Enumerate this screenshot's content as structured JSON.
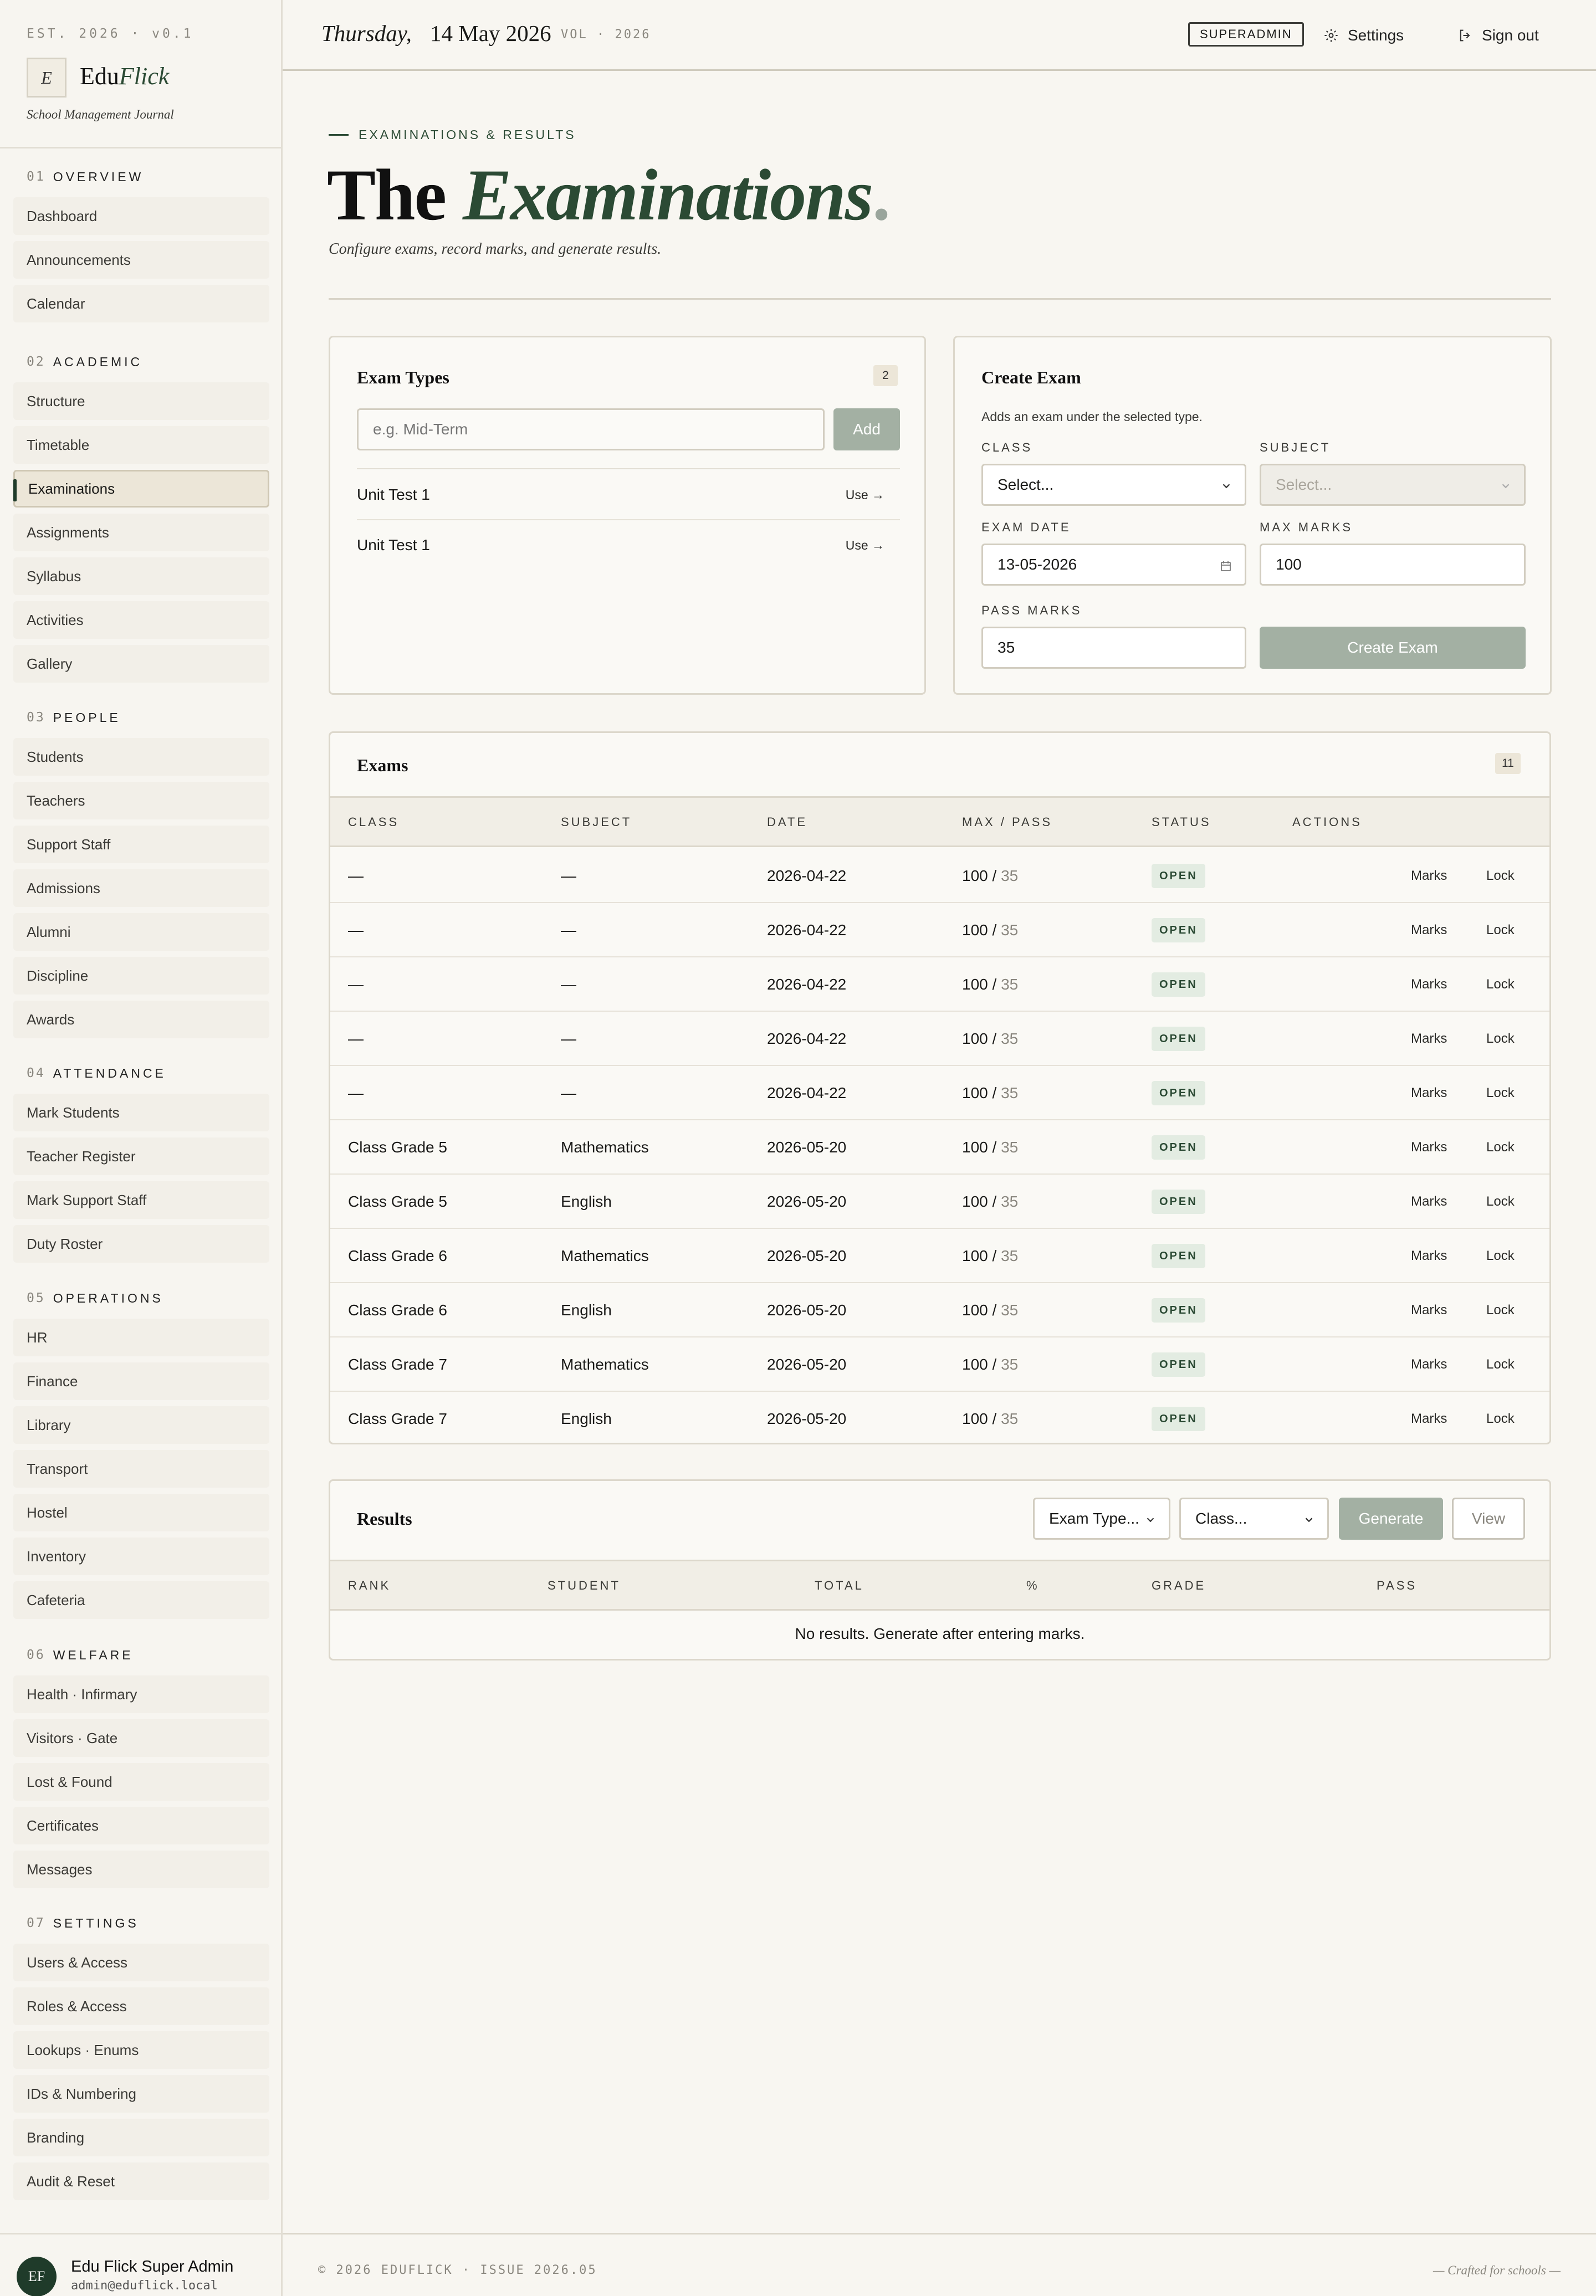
{
  "brand": {
    "est": "EST. 2026 · v0.1",
    "mark": "E",
    "name_prefix": "Edu",
    "name_suffix": "Flick",
    "tagline": "School Management Journal"
  },
  "nav": [
    {
      "num": "01",
      "heading": "OVERVIEW",
      "items": [
        "Dashboard",
        "Announcements",
        "Calendar"
      ]
    },
    {
      "num": "02",
      "heading": "ACADEMIC",
      "items": [
        "Structure",
        "Timetable",
        "Examinations",
        "Assignments",
        "Syllabus",
        "Activities",
        "Gallery"
      ]
    },
    {
      "num": "03",
      "heading": "PEOPLE",
      "items": [
        "Students",
        "Teachers",
        "Support Staff",
        "Admissions",
        "Alumni",
        "Discipline",
        "Awards"
      ]
    },
    {
      "num": "04",
      "heading": "ATTENDANCE",
      "items": [
        "Mark Students",
        "Teacher Register",
        "Mark Support Staff",
        "Duty Roster"
      ]
    },
    {
      "num": "05",
      "heading": "OPERATIONS",
      "items": [
        "HR",
        "Finance",
        "Library",
        "Transport",
        "Hostel",
        "Inventory",
        "Cafeteria"
      ]
    },
    {
      "num": "06",
      "heading": "WELFARE",
      "items": [
        "Health · Infirmary",
        "Visitors · Gate",
        "Lost & Found",
        "Certificates",
        "Messages"
      ]
    },
    {
      "num": "07",
      "heading": "SETTINGS",
      "items": [
        "Users & Access",
        "Roles & Access",
        "Lookups · Enums",
        "IDs & Numbering",
        "Branding",
        "Audit & Reset"
      ]
    }
  ],
  "active_nav": "Examinations",
  "user": {
    "initials": "EF",
    "name": "Edu Flick Super Admin",
    "email": "admin@eduflick.local"
  },
  "topbar": {
    "day": "Thursday,",
    "date": "14 May 2026",
    "vol": "VOL · 2026",
    "role": "SUPERADMIN",
    "settings": "Settings",
    "signout": "Sign out"
  },
  "page": {
    "eyebrow": "EXAMINATIONS & RESULTS",
    "title_plain": "The",
    "title_em": "Examinations",
    "title_dot": ".",
    "subtitle": "Configure exams, record marks, and generate results."
  },
  "exam_types": {
    "title": "Exam Types",
    "count": "2",
    "placeholder": "e.g. Mid-Term",
    "add": "Add",
    "items": [
      {
        "name": "Unit Test 1",
        "action": "Use →"
      },
      {
        "name": "Unit Test 1",
        "action": "Use →"
      }
    ]
  },
  "create_exam": {
    "title": "Create Exam",
    "hint": "Adds an exam under the selected type.",
    "class_label": "CLASS",
    "class_value": "Select...",
    "subject_label": "SUBJECT",
    "subject_value": "Select...",
    "date_label": "EXAM DATE",
    "date_value": "13-05-2026",
    "max_label": "MAX MARKS",
    "max_value": "100",
    "pass_label": "PASS MARKS",
    "pass_value": "35",
    "submit": "Create Exam"
  },
  "exams": {
    "title": "Exams",
    "count": "11",
    "columns": [
      "CLASS",
      "SUBJECT",
      "DATE",
      "MAX / PASS",
      "STATUS",
      "ACTIONS"
    ],
    "rows": [
      {
        "class": "—",
        "subject": "—",
        "date": "2026-04-22",
        "max": "100",
        "pass": "35",
        "status": "OPEN"
      },
      {
        "class": "—",
        "subject": "—",
        "date": "2026-04-22",
        "max": "100",
        "pass": "35",
        "status": "OPEN"
      },
      {
        "class": "—",
        "subject": "—",
        "date": "2026-04-22",
        "max": "100",
        "pass": "35",
        "status": "OPEN"
      },
      {
        "class": "—",
        "subject": "—",
        "date": "2026-04-22",
        "max": "100",
        "pass": "35",
        "status": "OPEN"
      },
      {
        "class": "—",
        "subject": "—",
        "date": "2026-04-22",
        "max": "100",
        "pass": "35",
        "status": "OPEN"
      },
      {
        "class": "Class Grade 5",
        "subject": "Mathematics",
        "date": "2026-05-20",
        "max": "100",
        "pass": "35",
        "status": "OPEN"
      },
      {
        "class": "Class Grade 5",
        "subject": "English",
        "date": "2026-05-20",
        "max": "100",
        "pass": "35",
        "status": "OPEN"
      },
      {
        "class": "Class Grade 6",
        "subject": "Mathematics",
        "date": "2026-05-20",
        "max": "100",
        "pass": "35",
        "status": "OPEN"
      },
      {
        "class": "Class Grade 6",
        "subject": "English",
        "date": "2026-05-20",
        "max": "100",
        "pass": "35",
        "status": "OPEN"
      },
      {
        "class": "Class Grade 7",
        "subject": "Mathematics",
        "date": "2026-05-20",
        "max": "100",
        "pass": "35",
        "status": "OPEN"
      },
      {
        "class": "Class Grade 7",
        "subject": "English",
        "date": "2026-05-20",
        "max": "100",
        "pass": "35",
        "status": "OPEN"
      }
    ],
    "marks_label": "Marks",
    "lock_label": "Lock",
    "separator": "/"
  },
  "results": {
    "title": "Results",
    "exam_type_value": "Exam Type...",
    "class_value": "Class...",
    "generate": "Generate",
    "view": "View",
    "columns": [
      "RANK",
      "STUDENT",
      "TOTAL",
      "%",
      "GRADE",
      "PASS"
    ],
    "empty": "No results. Generate after entering marks."
  },
  "footer": {
    "copy": "© 2026 EDUFLICK · ISSUE 2026.05",
    "craft": "— Crafted for schools —"
  },
  "colors": {
    "accent": "#2b4a34",
    "paper": "#f8f6f1",
    "sage_button": "#a3b0a3",
    "status_bg": "#e3ece2"
  }
}
